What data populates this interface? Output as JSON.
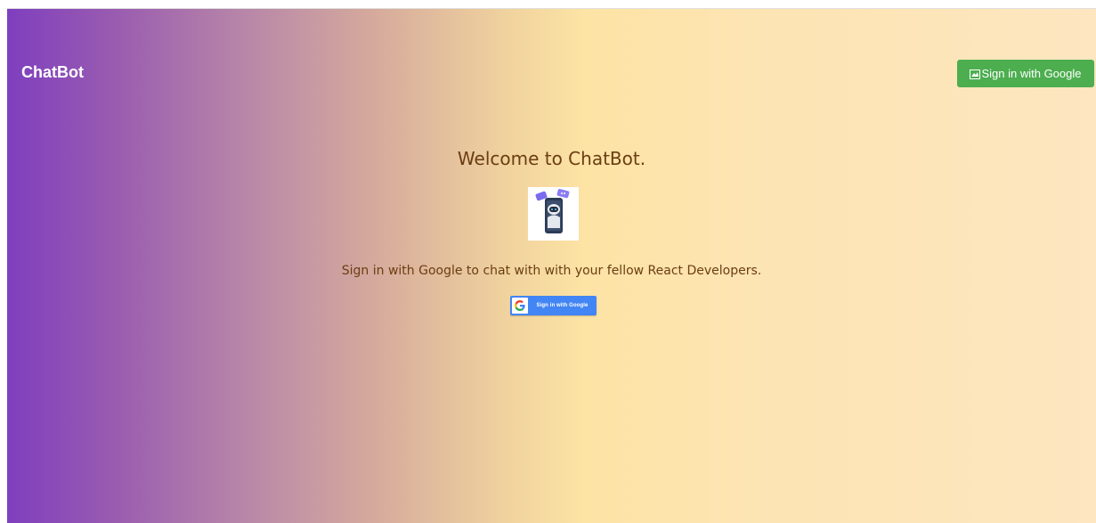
{
  "navbar": {
    "brand": "ChatBot",
    "signin_label": "Sign in with Google",
    "signin_color": "#4cae4f"
  },
  "main": {
    "welcome_title": "Welcome to ChatBot.",
    "bot_image_icon": "robot-with-phone-icon",
    "subtitle": "Sign in with Google to chat with with your fellow React Developers.",
    "google_button": {
      "label": "Sign in with Google",
      "icon": "google-g-icon",
      "color": "#4285f4"
    }
  },
  "theme": {
    "gradient_start": "#7f3fbf",
    "gradient_mid": "#fde3a4",
    "gradient_end": "#fde6c0",
    "text_color": "#6b3d12"
  }
}
